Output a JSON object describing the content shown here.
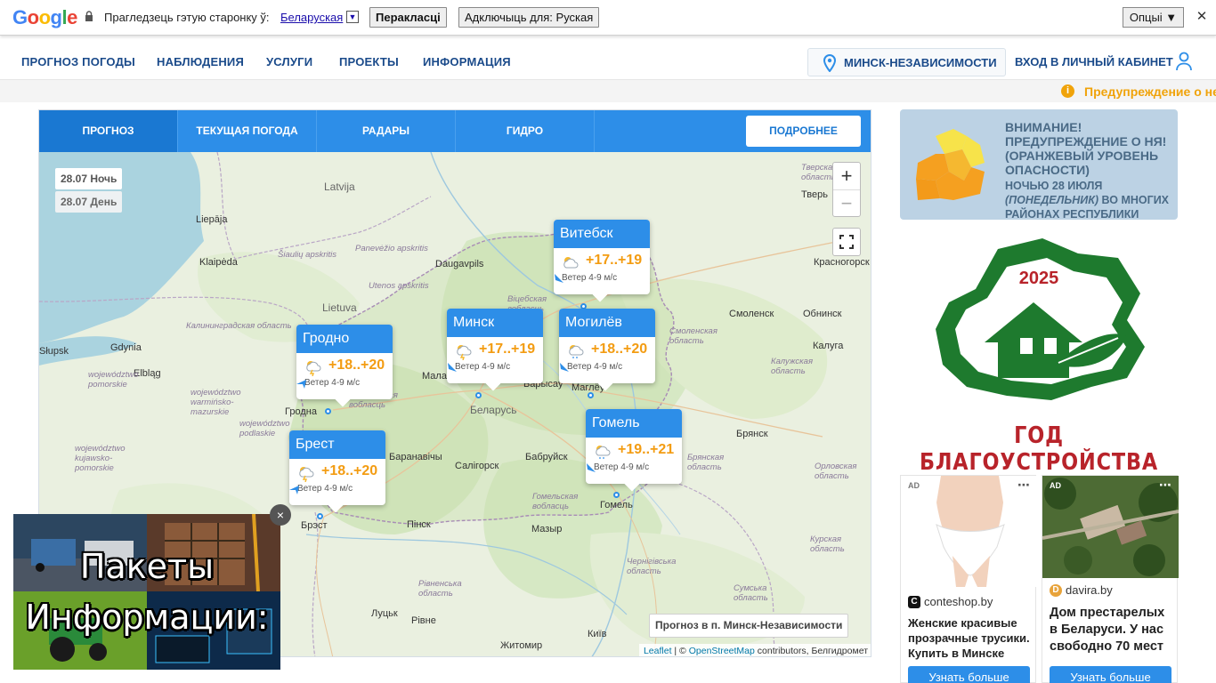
{
  "translate_bar": {
    "logo": "Google",
    "prompt": "Прагледзець гэтую старонку ў:",
    "language": "Беларуская",
    "translate_label": "Перакласці",
    "disable_label": "Адключыць для: Руская",
    "options_label": "Опцыі ▼",
    "close": "✕"
  },
  "nav": {
    "items": [
      "ПРОГНОЗ ПОГОДЫ",
      "НАБЛЮДЕНИЯ",
      "УСЛУГИ",
      "ПРОЕКТЫ",
      "ИНФОРМАЦИЯ"
    ],
    "location": "МИНСК-НЕЗАВИСИМОСТИ",
    "login": "ВХОД В ЛИЧНЫЙ КАБИНЕТ"
  },
  "warning_ticker": "Предупреждение о не",
  "tabs": [
    "ПРОГНОЗ",
    "ТЕКУЩАЯ ПОГОДА",
    "РАДАРЫ",
    "ГИДРО"
  ],
  "more_button": "ПОДРОБНЕЕ",
  "dates": [
    "28.07 Ночь",
    "28.07 День"
  ],
  "zoom": {
    "in": "+",
    "out": "−"
  },
  "cities": [
    {
      "name": "Витебск",
      "temp": "+17..+19",
      "wind": "Ветер 4-9 м/с"
    },
    {
      "name": "Гродно",
      "temp": "+18..+20",
      "wind": "Ветер 4-9 м/с"
    },
    {
      "name": "Минск",
      "temp": "+17..+19",
      "wind": "Ветер 4-9 м/с"
    },
    {
      "name": "Могилёв",
      "temp": "+18..+20",
      "wind": "Ветер 4-9 м/с"
    },
    {
      "name": "Брест",
      "temp": "+18..+20",
      "wind": "Ветер 4-9 м/с"
    },
    {
      "name": "Гомель",
      "temp": "+19..+21",
      "wind": "Ветер 4-9 м/с"
    }
  ],
  "map_labels": {
    "countries": [
      "Latvija",
      "Lietuva",
      "Беларусь"
    ],
    "cities": [
      "Liepāja",
      "Klaipėda",
      "Daugavpils",
      "Gdynia",
      "Elbląg",
      "Słupsk",
      "Гродна",
      "Брэст",
      "Баранавічы",
      "Салігорск",
      "Бабруйск",
      "Барысаў",
      "Малад",
      "Маглёў",
      "Гомель",
      "Пінск",
      "Мазыр",
      "Луцьк",
      "Рівне",
      "Житомир",
      "Київ",
      "Брянск",
      "Калуга",
      "Обнинск",
      "Смоленск",
      "Тверь",
      "Красногорск"
    ],
    "regions": [
      "Panevėžio apskritis",
      "Šiaulių apskritis",
      "Utenos apskritis",
      "Калининградская область",
      "województwo pomorskie",
      "województwo warmińsko-mazurskie",
      "województwo podlaskie",
      "województwo kujawsko-pomorskie",
      "Віцебская вобласць",
      "Гродзенская вобласць",
      "Смоленская область",
      "Калужская область",
      "Брянская область",
      "Орловская область",
      "Курская область",
      "Гомельская вобласць",
      "Чернігівська область",
      "Рівненська область",
      "Сумська область",
      "Тверская область"
    ]
  },
  "forecast_point": "Прогноз в п. Минск-Независимости",
  "attribution": {
    "leaflet": "Leaflet",
    "sep": " | © ",
    "osm": "OpenStreetMap",
    "rest": " contributors, Белгидромет"
  },
  "alert": {
    "title": "ВНИМАНИЕ! ПРЕДУПРЕЖДЕНИЕ О НЯ! (ОРАНЖЕВЫЙ УРОВЕНЬ ОПАСНОСТИ)",
    "body_1": "НОЧЬЮ 28 ИЮЛЯ ",
    "body_2": "(ПОНЕДЕЛЬНИК)",
    "body_3": " ВО МНОГИХ РАЙОНАХ РЕСПУБЛИКИ"
  },
  "banner": {
    "year": "2025",
    "caption": "ГОД БЛАГОУСТРОЙСТВА"
  },
  "ads": [
    {
      "tag": "AD",
      "source": "conteshop.by",
      "title": "Женские красивые прозрачные трусики. Купить в Минске",
      "button": "Узнать больше"
    },
    {
      "tag": "AD",
      "source": "davira.by",
      "title": "Дом престарелых в Беларуси. У нас свободно 70 мест",
      "button": "Узнать больше"
    }
  ],
  "video_ad": {
    "line1": "Пакеты",
    "line2": "Информации:",
    "close": "×"
  },
  "colors": {
    "primary": "#2d8ee8",
    "nav_text": "#1a4a8a",
    "temp": "#f39c12",
    "warning": "#f0a30a",
    "banner_red": "#b8232a",
    "banner_green": "#1e7a2e"
  }
}
